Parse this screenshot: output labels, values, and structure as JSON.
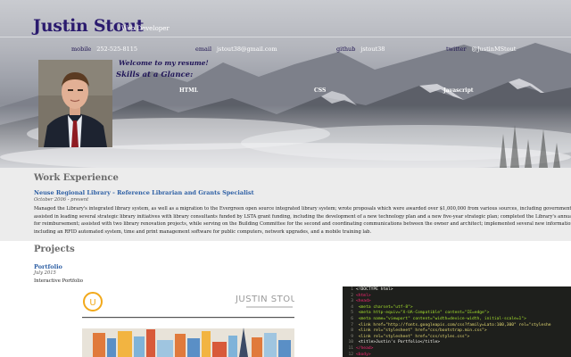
{
  "header": {
    "name": "Justin Stout",
    "role": "Web Developer",
    "contacts": [
      {
        "label": "mobile",
        "value": "252-525-8115"
      },
      {
        "label": "email",
        "value": "jstout38@gmail.com"
      },
      {
        "label": "github",
        "value": "jstout38"
      },
      {
        "label": "twitter",
        "value": "@JustinMStout"
      }
    ],
    "welcome": "Welcome to my resume!",
    "skills_title": "Skills at a Glance:",
    "skills": [
      "HTML",
      "CSS",
      "Javascript"
    ]
  },
  "work": {
    "section_title": "Work Experience",
    "job_title": "Neuse Regional Library - Reference Librarian and Grants Specialist",
    "job_dates": "October 2006 - present",
    "description_lines": [
      "Managed the Library's integrated library system, as well as a migration to the Evergreen open source integrated library system; wrote proposals which were awarded over $1,000,000 from various sources, including government, corpor",
      "assisted in leading several strategic library initiatives with library consultants funded by LSTA grant funding, including the development of a new technology plan and a new five-year strategic plan; completed the Library's annual USA",
      "for reimbursement; assisted with two library renovation projects, while serving on the Building Committee for the second and coordinating communications between the owner and architect; implemented several new information tech",
      "including an RFID automated system, time and print management software for public computers, network upgrades, and a mobile training lab."
    ]
  },
  "projects": {
    "section_title": "Projects",
    "items": [
      {
        "title": "Portfolio",
        "date": "July 2015",
        "description": "Interactive Portfolio"
      }
    ],
    "thumb_brand": "JUSTIN STOUT",
    "thumb_logo": "U",
    "code_lines": [
      {
        "n": "1",
        "text": "<!DOCTYPE html>"
      },
      {
        "n": "2",
        "text": "<html>"
      },
      {
        "n": "3",
        "text": "<head>"
      },
      {
        "n": "4",
        "text": "    <meta charset=\"utf-8\">"
      },
      {
        "n": "5",
        "text": "    <meta http-equiv=\"X-UA-Compatible\" content=\"IE=edge\">"
      },
      {
        "n": "6",
        "text": "    <meta name=\"viewport\" content=\"width=device-width, initial-scale=1\">"
      },
      {
        "n": "7",
        "text": "    <link href=\"http://fonts.googleapis.com/css?family=Lato:100,300\" rel=\"styleshe"
      },
      {
        "n": "8",
        "text": "    <link rel=\"stylesheet\" href=\"css/bootstrap.min.css\">"
      },
      {
        "n": "9",
        "text": "    <link rel=\"stylesheet\" href=\"css/styles.css\">"
      },
      {
        "n": "10",
        "text": "    <title>Justin's Portfolio</title>"
      },
      {
        "n": "11",
        "text": "</head>"
      },
      {
        "n": "12",
        "text": "<body>"
      }
    ]
  },
  "colors": {
    "name": "#2a1a6e",
    "link_blue": "#2d5fa4",
    "section_gray": "#6b6b6b",
    "work_bg": "#ececec",
    "code_bg": "#1e1f1c"
  }
}
